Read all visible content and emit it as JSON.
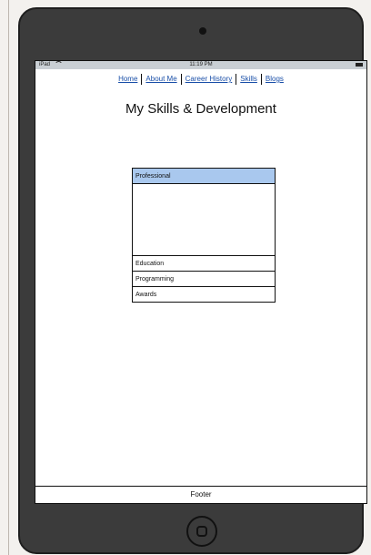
{
  "status_bar": {
    "device": "iPad",
    "time": "11:19 PM"
  },
  "nav": {
    "items": [
      {
        "label": "Home"
      },
      {
        "label": "About Me"
      },
      {
        "label": "Career History"
      },
      {
        "label": "Skills"
      },
      {
        "label": "Blogs"
      }
    ]
  },
  "page": {
    "title": "My Skills & Development"
  },
  "accordion": {
    "active_index": 0,
    "sections": [
      {
        "label": "Professional"
      },
      {
        "label": "Education"
      },
      {
        "label": "Programming"
      },
      {
        "label": "Awards"
      }
    ]
  },
  "footer": {
    "label": "Footer"
  },
  "colors": {
    "accent": "#a9c8ee",
    "link": "#1a4fa8",
    "device_body": "#3b3b3b"
  }
}
